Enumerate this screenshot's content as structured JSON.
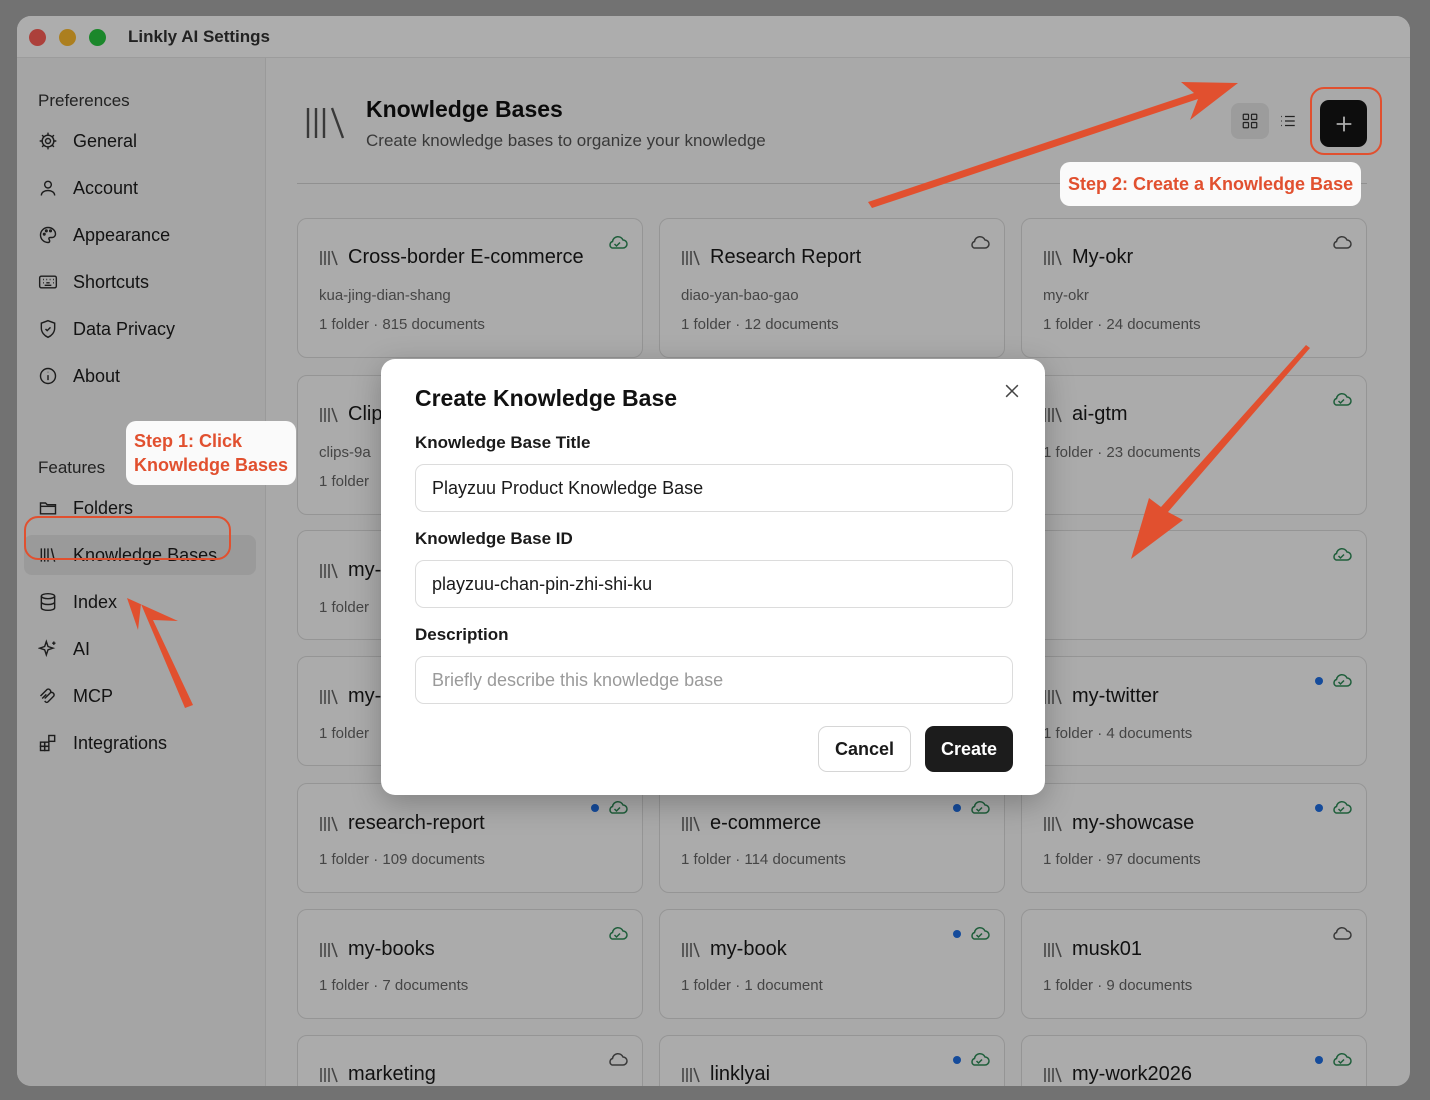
{
  "window": {
    "title": "Linkly AI Settings"
  },
  "sidebar": {
    "preferences_label": "Preferences",
    "preferences": [
      {
        "label": "General",
        "icon": "gear-icon"
      },
      {
        "label": "Account",
        "icon": "user-icon"
      },
      {
        "label": "Appearance",
        "icon": "palette-icon"
      },
      {
        "label": "Shortcuts",
        "icon": "keyboard-icon"
      },
      {
        "label": "Data Privacy",
        "icon": "shield-icon"
      },
      {
        "label": "About",
        "icon": "info-icon"
      }
    ],
    "features_label": "Features",
    "features": [
      {
        "label": "Folders",
        "icon": "folder-icon"
      },
      {
        "label": "Knowledge Bases",
        "icon": "library-icon",
        "active": true
      },
      {
        "label": "Index",
        "icon": "database-icon"
      },
      {
        "label": "AI",
        "icon": "sparkles-icon"
      },
      {
        "label": "MCP",
        "icon": "mcp-icon"
      },
      {
        "label": "Integrations",
        "icon": "puzzle-icon"
      }
    ]
  },
  "header": {
    "title": "Knowledge Bases",
    "subtitle": "Create knowledge bases to organize your knowledge"
  },
  "cards": [
    {
      "name": "Cross-border E-commerce",
      "slug": "kua-jing-dian-shang",
      "meta": "1 folder · 815 documents",
      "sync": "synced"
    },
    {
      "name": "Research Report",
      "slug": "diao-yan-bao-gao",
      "meta": "1 folder · 12 documents",
      "sync": "cloud"
    },
    {
      "name": "My-okr",
      "slug": "my-okr",
      "meta": "1 folder · 24 documents",
      "sync": "cloud"
    },
    {
      "name": "Clip",
      "slug": "clips-9a",
      "meta": "1 folder",
      "sync": ""
    },
    {
      "name": "",
      "slug": "",
      "meta": "",
      "sync": ""
    },
    {
      "name": "ai-gtm",
      "slug": "",
      "meta": "1 folder · 23 documents",
      "sync": "synced"
    },
    {
      "name": "my-",
      "slug": "",
      "meta": "1 folder",
      "sync": ""
    },
    {
      "name": "",
      "slug": "",
      "meta": "",
      "sync": ""
    },
    {
      "name": "",
      "slug": "",
      "meta": "",
      "sync": "synced"
    },
    {
      "name": "my-",
      "slug": "",
      "meta": "1 folder",
      "sync": ""
    },
    {
      "name": "",
      "slug": "",
      "meta": "",
      "sync": ""
    },
    {
      "name": "my-twitter",
      "slug": "",
      "meta": "1 folder · 4 documents",
      "sync": "synced-dot"
    },
    {
      "name": "research-report",
      "slug": "",
      "meta": "1 folder · 109 documents",
      "sync": "synced-dot"
    },
    {
      "name": "e-commerce",
      "slug": "",
      "meta": "1 folder · 114 documents",
      "sync": "synced-dot"
    },
    {
      "name": "my-showcase",
      "slug": "",
      "meta": "1 folder · 97 documents",
      "sync": "synced-dot"
    },
    {
      "name": "my-books",
      "slug": "",
      "meta": "1 folder · 7 documents",
      "sync": "synced"
    },
    {
      "name": "my-book",
      "slug": "",
      "meta": "1 folder · 1 document",
      "sync": "synced-dot"
    },
    {
      "name": "musk01",
      "slug": "",
      "meta": "1 folder · 9 documents",
      "sync": "cloud"
    },
    {
      "name": "marketing",
      "slug": "",
      "meta": "",
      "sync": "cloud"
    },
    {
      "name": "linklyai",
      "slug": "",
      "meta": "",
      "sync": "synced-dot"
    },
    {
      "name": "my-work2026",
      "slug": "",
      "meta": "",
      "sync": "synced-dot"
    }
  ],
  "modal": {
    "title": "Create Knowledge Base",
    "title_label": "Knowledge Base Title",
    "title_value": "Playzuu Product Knowledge Base",
    "id_label": "Knowledge Base ID",
    "id_value": "playzuu-chan-pin-zhi-shi-ku",
    "desc_label": "Description",
    "desc_placeholder": "Briefly describe this knowledge base",
    "cancel": "Cancel",
    "create": "Create"
  },
  "callouts": {
    "step1_line1": "Step 1: Click",
    "step1_line2": "Knowledge Bases",
    "step2": "Step 2: Create a Knowledge Base"
  },
  "colors": {
    "accent": "#e1502f",
    "primary_button": "#1c1c1c",
    "sync_green": "#2e8b57",
    "unread_blue": "#1f6fe5"
  }
}
